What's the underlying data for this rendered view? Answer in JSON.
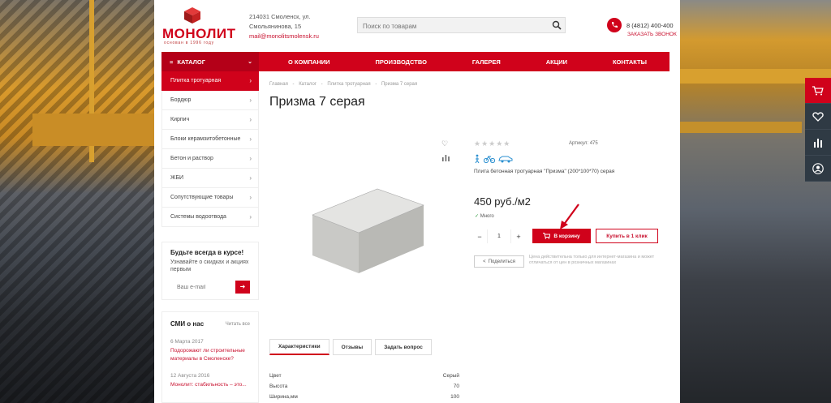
{
  "header": {
    "logo_text": "МОНОЛИТ",
    "logo_sub": "основан в 1996 году",
    "address_line1": "214031 Смоленск, ул.",
    "address_line2": "Смольянинова, 15",
    "email": "mail@monolitsmolensk.ru",
    "search_placeholder": "Поиск по товарам",
    "phone": "8 (4812) 400-400",
    "callback": "Заказать звонок"
  },
  "nav": {
    "catalog": "КАТАЛОГ",
    "items": [
      "О КОМПАНИИ",
      "ПРОИЗВОДСТВО",
      "ГАЛЕРЕЯ",
      "АКЦИИ",
      "КОНТАКТЫ"
    ]
  },
  "sidebar": {
    "items": [
      "Плитка тротуарная",
      "Бордюр",
      "Кирпич",
      "Блоки керамзитобетонные",
      "Бетон и раствор",
      "ЖБИ",
      "Сопутствующие товары",
      "Системы водоотвода"
    ]
  },
  "subscribe": {
    "title": "Будьте всегда в курсе!",
    "subtitle": "Узнавайте о скидках и акциях первым",
    "placeholder": "Ваш e-mail",
    "button": "➜"
  },
  "smi": {
    "title": "СМИ о нас",
    "all": "Читать все",
    "date1": "6 Марта 2017",
    "link1": "Подорожают ли строительные материалы в Смоленске?",
    "date2": "12 Августа 2016",
    "link2": "Монолит: стабильность – это..."
  },
  "breadcrumbs": [
    "Главная",
    "-",
    "Каталог",
    "-",
    "Плитка тротуарная",
    "-",
    "Призма 7 серая"
  ],
  "product": {
    "title": "Призма 7 серая",
    "article_label": "Артикул:",
    "article": "475",
    "description": "Плита бетонная тротуарная \"Призма\" (200*100*70) серая",
    "price": "450 руб./м2",
    "stock": "Много",
    "quantity": "1",
    "add_to_cart": "В корзину",
    "buy_one_click": "Купить в 1 клик",
    "share": "Поделиться",
    "note": "Цена действительна только для интернет-магазина и может отличаться от цен в розничных магазинах"
  },
  "tabs": [
    "Характеристики",
    "Отзывы",
    "Задать вопрос"
  ],
  "specs": [
    {
      "name": "Цвет",
      "value": "Серый"
    },
    {
      "name": "Высота",
      "value": "70"
    },
    {
      "name": "Ширина,мм",
      "value": "100"
    }
  ],
  "colors": {
    "brand": "#d0021b",
    "dark": "#2f3a44"
  }
}
